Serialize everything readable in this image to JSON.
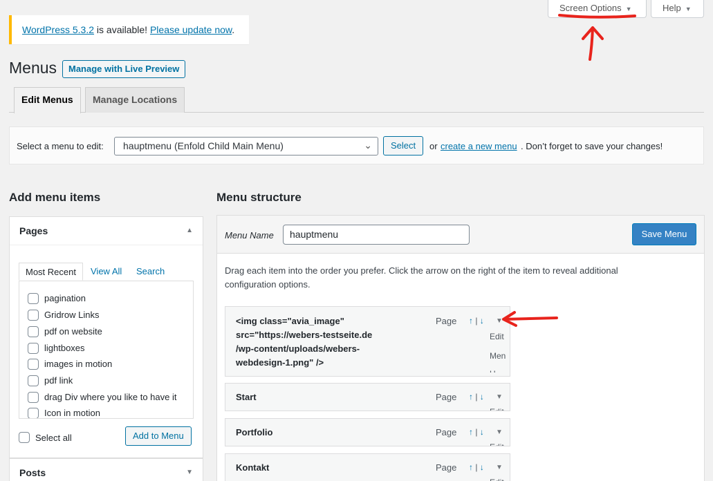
{
  "screen_meta": {
    "screen_options_label": "Screen Options",
    "help_label": "Help"
  },
  "notice": {
    "version_link": "WordPress 5.3.2",
    "middle_text": " is available! ",
    "update_link": "Please update now",
    "end_text": "."
  },
  "header": {
    "title": "Menus",
    "live_preview_label": "Manage with Live Preview"
  },
  "tabs": {
    "edit_menus": "Edit Menus",
    "manage_locations": "Manage Locations"
  },
  "manage_bar": {
    "label": "Select a menu to edit:",
    "selected_menu": "hauptmenu (Enfold Child Main Menu)",
    "select_button": "Select",
    "or_text": "or",
    "create_link": "create a new menu",
    "save_hint": ". Don’t forget to save your changes!"
  },
  "left": {
    "heading": "Add menu items",
    "pages_title": "Pages",
    "posts_title": "Posts",
    "mini_tabs": [
      "Most Recent",
      "View All",
      "Search"
    ],
    "pages": [
      "pagination",
      "Gridrow Links",
      "pdf on website",
      "lightboxes",
      "images in motion",
      "pdf link",
      "drag Div where you like to have it",
      "Icon in motion"
    ],
    "select_all_label": "Select all",
    "add_to_menu_label": "Add to Menu"
  },
  "right": {
    "heading": "Menu structure",
    "menu_name_label": "Menu Name",
    "menu_name_value": "hauptmenu",
    "save_menu_label": "Save Menu",
    "drag_info": "Drag each item into the order you prefer. Click the arrow on the right of the item to reveal additional configuration options.",
    "items": [
      {
        "title_lines": [
          "<img class=\"avia_image\"",
          "src=\"https://webers-testseite.de",
          "/wp-content/uploads/webers-",
          "webdesign-1.png\" />"
        ],
        "type": "Page",
        "side_lines": [
          "Edit",
          "Men",
          "U"
        ]
      },
      {
        "title_lines": [
          "Start"
        ],
        "type": "Page",
        "side_lines": [
          "Edit"
        ]
      },
      {
        "title_lines": [
          "Portfolio"
        ],
        "type": "Page",
        "side_lines": [
          "Edit"
        ]
      },
      {
        "title_lines": [
          "Kontakt"
        ],
        "type": "Page",
        "side_lines": [
          "Edit"
        ]
      }
    ],
    "move_up": "↑",
    "move_sep": "|",
    "move_down": "↓"
  },
  "colors": {
    "accent": "#0073aa",
    "annotation": "#e8231c",
    "notice_border": "#ffb900",
    "primary_button": "#3582c4"
  }
}
